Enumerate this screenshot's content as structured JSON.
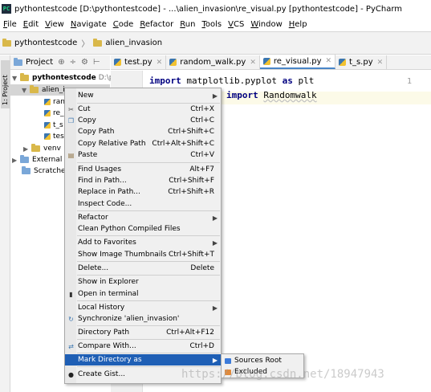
{
  "window": {
    "icon": "PC",
    "title": "pythontestcode [D:\\pythontestcode] - ...\\alien_invasion\\re_visual.py [pythontestcode] - PyCharm"
  },
  "menubar": [
    {
      "u": "F",
      "rest": "ile"
    },
    {
      "u": "E",
      "rest": "dit"
    },
    {
      "u": "V",
      "rest": "iew"
    },
    {
      "u": "N",
      "rest": "avigate"
    },
    {
      "u": "C",
      "rest": "ode"
    },
    {
      "u": "R",
      "rest": "efactor"
    },
    {
      "u": "R",
      "rest": "un"
    },
    {
      "u": "T",
      "rest": "ools"
    },
    {
      "u": "V",
      "rest": "CS"
    },
    {
      "u": "W",
      "rest": "indow"
    },
    {
      "u": "H",
      "rest": "elp"
    }
  ],
  "breadcrumb": {
    "root": "pythontestcode",
    "sep": "〉",
    "child": "alien_invasion"
  },
  "side_tab": "1: Project",
  "project_panel": {
    "label": "Project",
    "icons": [
      "⊕",
      "÷",
      "⚙",
      "⊢"
    ]
  },
  "tabs": [
    {
      "label": "test.py",
      "active": false
    },
    {
      "label": "random_walk.py",
      "active": false
    },
    {
      "label": "re_visual.py",
      "active": true
    },
    {
      "label": "t_s.py",
      "active": false
    }
  ],
  "tree": {
    "root_label": "pythontestcode",
    "root_path": "D:\\pyt",
    "selected": "alien_in",
    "files": [
      "ran",
      "re_",
      "t_s",
      "tes"
    ],
    "venv": "venv",
    "external": "External L",
    "scratches": "Scratches"
  },
  "editor": {
    "line_number": "1",
    "line1_kw1": "import",
    "line1_mod": " matplotlib.pyplot ",
    "line1_kw2": "as",
    "line1_alias": " plt",
    "line2_kw": "import",
    "line2_mod": "Randomwalk"
  },
  "context_menu": {
    "new": "New",
    "cut": "Cut",
    "cut_sc": "Ctrl+X",
    "copy": "Copy",
    "copy_sc": "Ctrl+C",
    "copy_path": "Copy Path",
    "copy_path_sc": "Ctrl+Shift+C",
    "copy_rel": "Copy Relative Path",
    "copy_rel_sc": "Ctrl+Alt+Shift+C",
    "paste": "Paste",
    "paste_sc": "Ctrl+V",
    "find_usages": "Find Usages",
    "find_usages_sc": "Alt+F7",
    "find_in_path": "Find in Path...",
    "find_in_path_sc": "Ctrl+Shift+F",
    "replace_in_path": "Replace in Path...",
    "replace_in_path_sc": "Ctrl+Shift+R",
    "inspect": "Inspect Code...",
    "refactor": "Refactor",
    "clean": "Clean Python Compiled Files",
    "favorites": "Add to Favorites",
    "thumbs": "Show Image Thumbnails",
    "thumbs_sc": "Ctrl+Shift+T",
    "delete": "Delete...",
    "delete_sc": "Delete",
    "explorer": "Show in Explorer",
    "terminal": "Open in terminal",
    "history": "Local History",
    "sync": "Synchronize 'alien_invasion'",
    "dir_path": "Directory Path",
    "dir_path_sc": "Ctrl+Alt+F12",
    "compare": "Compare With...",
    "compare_sc": "Ctrl+D",
    "mark_dir": "Mark Directory as",
    "gist": "Create Gist..."
  },
  "submenu": {
    "sources_root": "Sources Root",
    "excluded": "Excluded"
  },
  "watermark": "https://blog.csdn.net/18947943",
  "colors": {
    "highlight": "#1f5fb5",
    "sources_root": "#3d7bd9",
    "excluded": "#e08a3c",
    "accent": "#4a86c8"
  }
}
